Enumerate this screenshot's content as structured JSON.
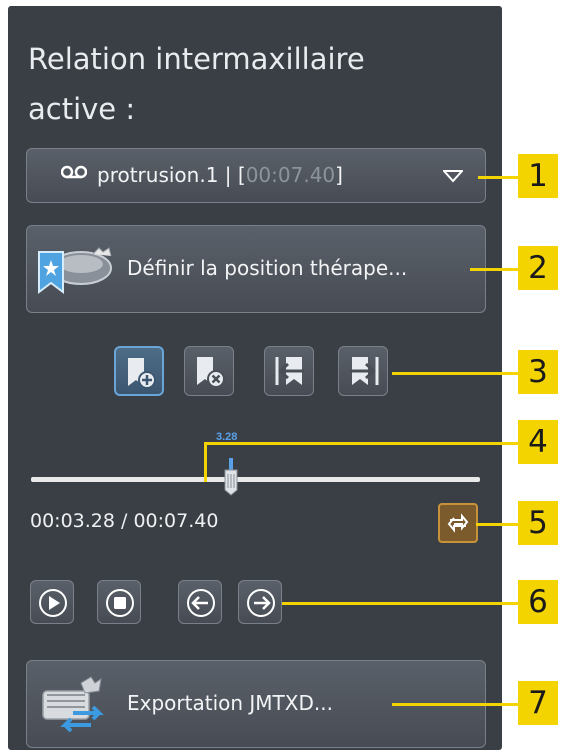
{
  "panel": {
    "title": "Relation intermaxillaire active :"
  },
  "dropdown": {
    "name": "protrusion.1",
    "separator": " | [",
    "time": "00:07.40",
    "close": "]",
    "icon": "recording-icon",
    "arrow_icon": "chevron-down-icon"
  },
  "therapeutic_button": {
    "label": "Définir la position thérape...",
    "icon": "jaw-bookmark-icon"
  },
  "bookmark_buttons": [
    {
      "name": "add-bookmark-button",
      "icon": "bookmark-add-icon",
      "active": true
    },
    {
      "name": "remove-bookmark-button",
      "icon": "bookmark-remove-icon",
      "active": false
    },
    {
      "name": "previous-bookmark-button",
      "icon": "bookmark-prev-icon",
      "active": false
    },
    {
      "name": "next-bookmark-button",
      "icon": "bookmark-next-icon",
      "active": false
    }
  ],
  "slider": {
    "value_label": "3.28",
    "position_fraction": 0.443
  },
  "time_readout": "00:03.28 / 00:07.40",
  "loop_button": {
    "icon": "loop-icon"
  },
  "playback_buttons": [
    {
      "name": "play-button",
      "icon": "play-icon"
    },
    {
      "name": "stop-button",
      "icon": "stop-icon"
    },
    {
      "name": "step-back-button",
      "icon": "arrow-left-icon"
    },
    {
      "name": "step-forward-button",
      "icon": "arrow-right-icon"
    }
  ],
  "export_button": {
    "label": "Exportation JMTXD...",
    "icon": "export-icon"
  },
  "callouts": [
    "1",
    "2",
    "3",
    "4",
    "5",
    "6",
    "7"
  ],
  "colors": {
    "panel_bg": "#3a3f46",
    "callout": "#f4d400",
    "accent_blue": "#5aa0e6",
    "loop_orange": "#c8923a"
  }
}
